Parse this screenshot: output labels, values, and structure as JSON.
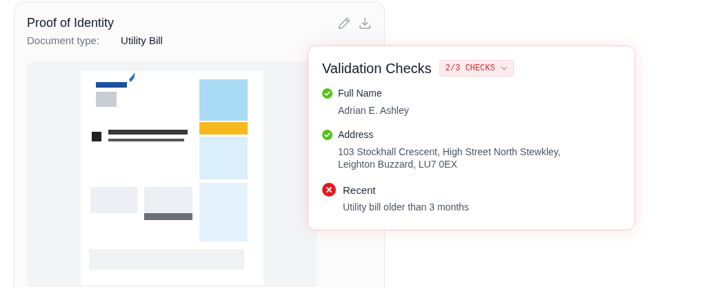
{
  "document_card": {
    "title": "Proof of Identity",
    "type_label": "Document type:",
    "type_value": "Utility Bill"
  },
  "validation": {
    "title": "Validation Checks",
    "badge": "2/3 CHECKS",
    "checks": [
      {
        "label": "Full Name",
        "detail": "Adrian E. Ashley",
        "passed": true
      },
      {
        "label": "Address",
        "detail": "103 Stockhall Crescent, High Street North Stewkley, Leighton Buzzard, LU7 0EX",
        "passed": true
      },
      {
        "label": "Recent",
        "detail": "Utility bill older than 3 months",
        "passed": false
      }
    ]
  }
}
